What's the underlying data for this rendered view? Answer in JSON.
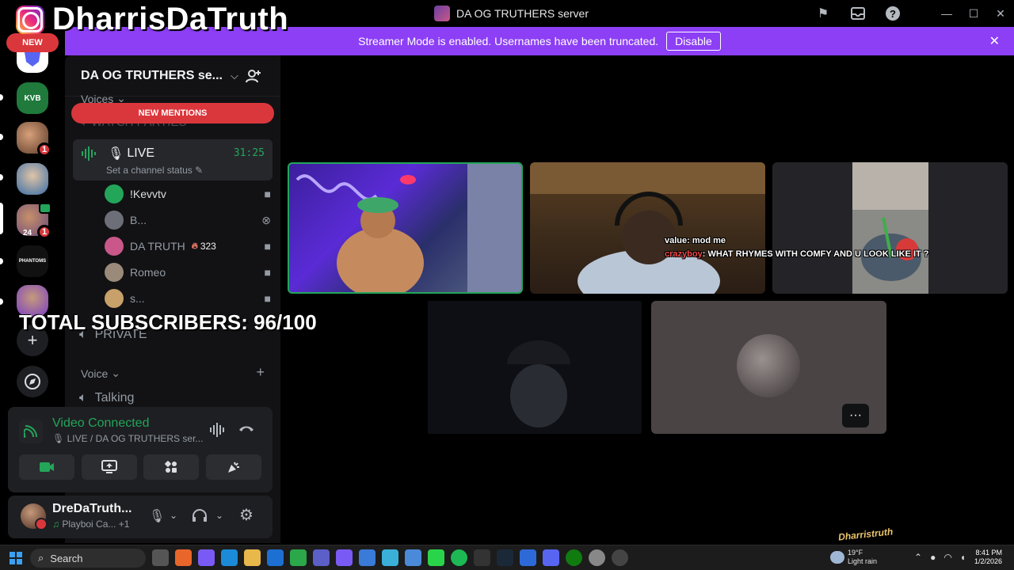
{
  "overlay": {
    "brand_name": "DharrisDaTruth",
    "subscribers": "TOTAL SUBSCRIBERS: 96/100",
    "watermark": "Dharristruth"
  },
  "titlebar": {
    "server_title": "DA OG TRUTHERS server",
    "icons": [
      "flag-icon",
      "inbox-icon",
      "help-icon"
    ],
    "window_controls": [
      "minimize",
      "maximize",
      "close"
    ]
  },
  "banner": {
    "text": "Streamer Mode is enabled. Usernames have been truncated.",
    "button": "Disable",
    "color": "#8c3ff5"
  },
  "rail": {
    "new_label": "NEW",
    "servers": [
      {
        "name": "server-shield",
        "color": "#ffffff",
        "badge": ""
      },
      {
        "name": "server-kvb",
        "label": "KVB",
        "color": "#1f7a3c",
        "badge": ""
      },
      {
        "name": "server-friends",
        "color": "#8a5a3c",
        "badge": "1"
      },
      {
        "name": "server-dancer",
        "color": "#3a6ea5",
        "badge": ""
      },
      {
        "name": "server-community",
        "color": "#6a4a7a",
        "badge": "1",
        "sub": "24"
      },
      {
        "name": "server-phantoms",
        "label": "PHANTOMS",
        "color": "#111111",
        "badge": ""
      },
      {
        "name": "server-og-truthers",
        "color": "#7a3ec5",
        "badge": ""
      }
    ]
  },
  "sidebar": {
    "server_name": "DA OG TRUTHERS se...",
    "category_voices": "Voices",
    "new_mentions": "NEW MENTIONS",
    "watch_parties": "WATCH PARTIES",
    "live_channel": {
      "name": "LIVE",
      "timer": "31:25",
      "status": "Set a channel status"
    },
    "members": [
      {
        "name": "!Kevvtv",
        "icon": "video-icon",
        "color": "#23a55a",
        "dim": false
      },
      {
        "name": "B...",
        "icon": "xbox-icon",
        "color": "#6d6f78",
        "dim": true
      },
      {
        "name": "DA TRUTH",
        "icon": "video-icon",
        "color": "#c9578a",
        "dim": true,
        "streak": "323"
      },
      {
        "name": "Romeo",
        "icon": "video-icon",
        "color": "#9a8a7a",
        "dim": true
      },
      {
        "name": "s...",
        "icon": "video-icon",
        "color": "#c8a06a",
        "dim": true
      }
    ],
    "private_channel": "PRIVATE",
    "category_voice": "Voice",
    "talking_channel": "Talking"
  },
  "voice_panel": {
    "title": "Video Connected",
    "subtitle": "LIVE / DA OG TRUTHERS ser...",
    "buttons": [
      "camera-icon",
      "screenshare-icon",
      "activities-icon",
      "soundboard-icon"
    ]
  },
  "user_panel": {
    "username": "DreDaTruth...",
    "activity": "Playboi Ca...",
    "extra": "+1"
  },
  "stage": {
    "chat": [
      {
        "user": "value",
        "text": "mod me"
      },
      {
        "user": "crazyboy",
        "text": "WHAT RHYMES WITH COMFY AND U LOOK LIKE IT ?"
      }
    ],
    "more_label": "···"
  },
  "taskbar": {
    "search": "Search",
    "weather_temp": "19°F",
    "weather_desc": "Light rain",
    "time": "8:41 PM",
    "date": "1/2/2026"
  }
}
